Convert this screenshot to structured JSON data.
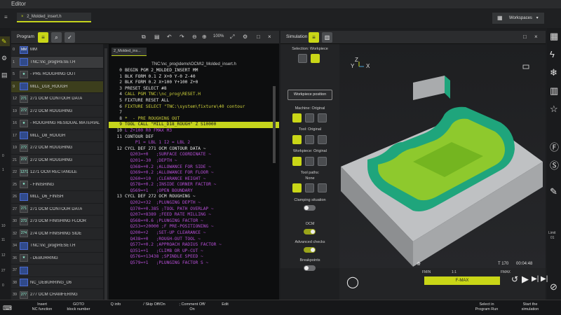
{
  "app": {
    "title": "Editor"
  },
  "file_tab": {
    "label": "2_Molded_insert.h"
  },
  "workspaces": {
    "label": "Workspaces"
  },
  "program_panel": {
    "title": "Program",
    "zoom": "100%",
    "items": [
      {
        "num": "0",
        "icon": "MM",
        "label": "MM"
      },
      {
        "num": "1",
        "icon": "",
        "label": "TNC:\\nc_prog\\RESET.H"
      },
      {
        "num": "5",
        "icon": "★",
        "label": "- PRE ROUGHING OUT"
      },
      {
        "num": "9",
        "icon": "",
        "label": "MILL_D18_ROUGH"
      },
      {
        "num": "12",
        "icon": "271",
        "label": "271 OCM CONTOUR DATA"
      },
      {
        "num": "19",
        "icon": "272",
        "label": "272 OCM ROUGHING"
      },
      {
        "num": "16",
        "icon": "★",
        "label": "- ROUGHING RESIDUAL MATERIAL"
      },
      {
        "num": "17",
        "icon": "",
        "label": "MILL_D8_ROUGH"
      },
      {
        "num": "19",
        "icon": "272",
        "label": "272 OCM ROUGHING"
      },
      {
        "num": "21",
        "icon": "272",
        "label": "272 OCM ROUGHING"
      },
      {
        "num": "22",
        "icon": "1271",
        "label": "1271 OCM RECTANGLE"
      },
      {
        "num": "25",
        "icon": "★",
        "label": "- FINISHING"
      },
      {
        "num": "26",
        "icon": "",
        "label": "MILL_D6_FINISH"
      },
      {
        "num": "27",
        "icon": "271",
        "label": "271 OCM CONTOUR DATA"
      },
      {
        "num": "30",
        "icon": "273",
        "label": "273 OCM FINISHING FLOOR"
      },
      {
        "num": "32",
        "icon": "274",
        "label": "274 OCM FINISHING SIDE"
      },
      {
        "num": "34",
        "icon": "",
        "label": "TNC:\\nc_prog\\RESET.H"
      },
      {
        "num": "36",
        "icon": "★",
        "label": "- DEBURRING"
      },
      {
        "num": "37",
        "icon": "",
        "label": ""
      },
      {
        "num": "38",
        "icon": "",
        "label": "NC_DEBURRING_D6"
      },
      {
        "num": "39",
        "icon": "277",
        "label": "277 OCM CHAMFERING"
      }
    ]
  },
  "editor": {
    "tab": "2_Molded_ins...",
    "path": "TNC:\\nc_prog\\demo\\OCM\\2_Molded_insert.h",
    "lines": [
      {
        "n": "0",
        "t": "BEGIN PGM 2_MOLDED_INSERT MM",
        "c": ""
      },
      {
        "n": "1",
        "t": "BLK FORM 0.1 Z X+0 Y-0 Z-40",
        "c": ""
      },
      {
        "n": "2",
        "t": "BLK FORM 0.2 X+100 Y+100 Z+0",
        "c": ""
      },
      {
        "n": "3",
        "t": "PRESET SELECT #8",
        "c": ""
      },
      {
        "n": "4",
        "t": "CALL PGM TNC:\\nc_prog\\RESET.H",
        "c": ""
      },
      {
        "n": "5",
        "t": "FIXTURE RESET ALL",
        "c": ""
      },
      {
        "n": "6",
        "t": "FIXTURE SELECT \"TNC:\\system\\fixture\\40 contour",
        "c": ""
      },
      {
        "n": "7",
        "t": "",
        "c": ""
      },
      {
        "n": "8",
        "t": "*  - PRE ROUGHING OUT",
        "c": ""
      },
      {
        "n": "9",
        "t": "TOOL CALL \"MILL_D18_ROUGH\" Z S10000",
        "c": ""
      },
      {
        "n": "10",
        "t": "L Z+100 R0 FMAX M3",
        "c": ""
      },
      {
        "n": "11",
        "t": "CONTOUR DEF",
        "c": ""
      },
      {
        "n": "",
        "t": "    P1 = LBL 1 I2 = LBL 2",
        "c": ""
      },
      {
        "n": "12",
        "t": "CYCL DEF 271 OCM CONTOUR DATA ~",
        "c": ""
      },
      {
        "n": "",
        "t": "  Q203=+0   ;SURFACE COORDINATE ~",
        "c": ""
      },
      {
        "n": "",
        "t": "  Q201=-30  ;DEPTH ~",
        "c": ""
      },
      {
        "n": "",
        "t": "  Q368=+0.2 ;ALLOWANCE FOR SIDE ~",
        "c": ""
      },
      {
        "n": "",
        "t": "  Q369=+0.2 ;ALLOWANCE FOR FLOOR ~",
        "c": ""
      },
      {
        "n": "",
        "t": "  Q260=+10  ;CLEARANCE HEIGHT ~",
        "c": ""
      },
      {
        "n": "",
        "t": "  Q578=+0.2 ;INSIDE CORNER FACTOR ~",
        "c": ""
      },
      {
        "n": "",
        "t": "  Q569=+1   ;OPEN BOUNDARY",
        "c": ""
      },
      {
        "n": "13",
        "t": "CYCL DEF 272 OCM ROUGHING ~",
        "c": ""
      },
      {
        "n": "",
        "t": "  Q202=+32  ;PLUNGING DEPTH ~",
        "c": ""
      },
      {
        "n": "",
        "t": "  Q370=+0.385 ;TOOL PATH OVERLAP ~",
        "c": ""
      },
      {
        "n": "",
        "t": "  Q207=+8389 ;FEED RATE MILLING ~",
        "c": ""
      },
      {
        "n": "",
        "t": "  Q568=+0.6 ;PLUNGING FACTOR ~",
        "c": ""
      },
      {
        "n": "",
        "t": "  Q253=+20000 ;F PRE-POSITIONING ~",
        "c": ""
      },
      {
        "n": "",
        "t": "  Q200=+2   ;SET-UP CLEARANCE ~",
        "c": ""
      },
      {
        "n": "",
        "t": "  Q438=+0   ;ROUGH-OUT TOOL ~",
        "c": ""
      },
      {
        "n": "",
        "t": "  Q577=+0.2 ;APPROACH RADIUS FACTOR ~",
        "c": ""
      },
      {
        "n": "",
        "t": "  Q351=+1   ;CLIMB OR UP-CUT ~",
        "c": ""
      },
      {
        "n": "",
        "t": "  Q576=+13438 ;SPINDLE SPEED ~",
        "c": ""
      },
      {
        "n": "",
        "t": "  Q579=+1   ;PLUNGING FACTOR S ~",
        "c": ""
      }
    ]
  },
  "simulation": {
    "title": "Simulation",
    "selection_label": "Selection: Workpiece",
    "workpiece_btn": "Workpiece position",
    "machine_label": "Machine: Original",
    "tool_label": "Tool: Original",
    "workpiece_label": "Workpiece: Original",
    "toolpaths_label": "Tool paths:",
    "toolpaths_value": "None",
    "clamping_label": "Clamping situation",
    "ocm_label": "OCM",
    "advanced_label": "Advanced checks",
    "breakpoints_label": "Breakpoints",
    "axis_y": "Y",
    "axis_x": "X",
    "axis_z": "Z",
    "status_t": "T 170",
    "status_time": "00:04:48",
    "fmin": "FMIN",
    "ratio": "1:1",
    "fmax": "FMAX",
    "bar_label": "F-MAX"
  },
  "bottom": [
    {
      "l1": "Insert",
      "l2": "NC function"
    },
    {
      "l1": "GOTO",
      "l2": "block number"
    },
    {
      "l1": "Q info",
      "l2": ""
    },
    {
      "l1": "/ Skip Off/On",
      "l2": ""
    },
    {
      "l1": "; Comment Off/",
      "l2": "On"
    },
    {
      "l1": "Edit",
      "l2": ""
    },
    {
      "l1": "Select in",
      "l2": "Program Run"
    },
    {
      "l1": "Start the",
      "l2": "simulation"
    }
  ],
  "left_rail_nums": [
    "0",
    "1",
    "10",
    "11",
    "12",
    "27",
    "0"
  ],
  "right_rail_text": {
    "l1": "Limit",
    "l2": "01"
  },
  "colors": {
    "accent": "#c9d617",
    "part": "#1fa57c",
    "floor": "#8ec92d"
  }
}
